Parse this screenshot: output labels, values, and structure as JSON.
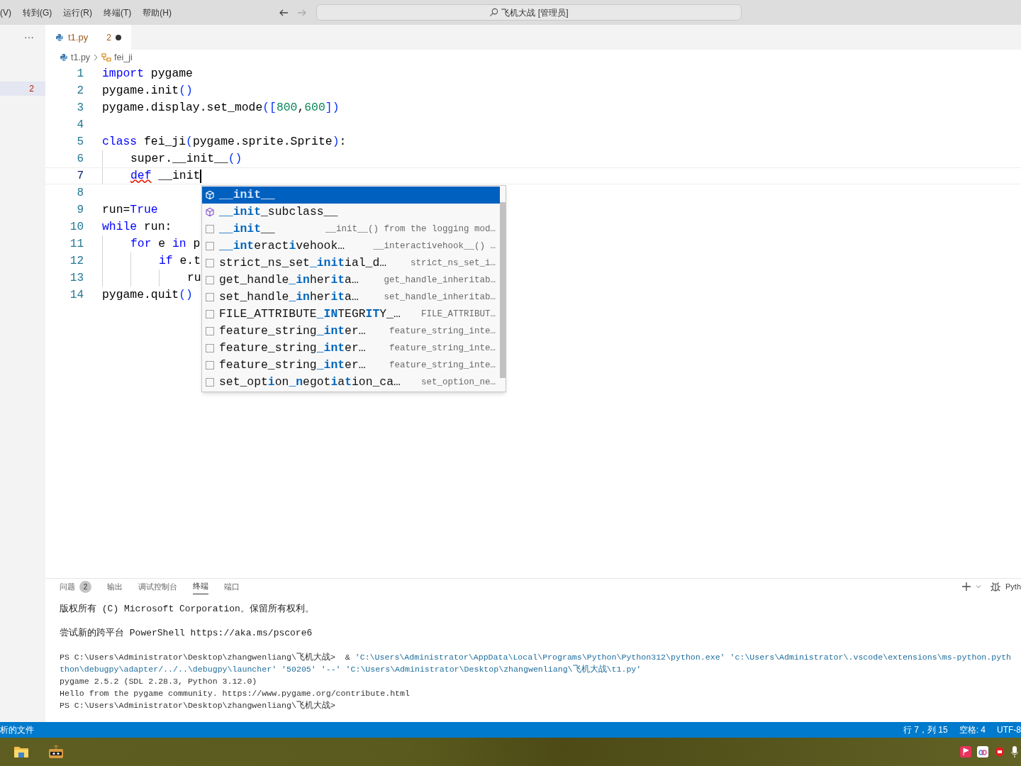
{
  "menu": [
    "(V)",
    "转到(G)",
    "运行(R)",
    "终端(T)",
    "帮助(H)"
  ],
  "search": {
    "value": "飞机大战 [管理员]"
  },
  "sidebar": {
    "more": "···",
    "problem_count": "2"
  },
  "tabs": [
    {
      "label": "t1.py",
      "badge": "2",
      "modified": true,
      "selected": true
    }
  ],
  "breadcrumb": [
    "t1.py",
    "fei_ji"
  ],
  "code": {
    "lines": [
      {
        "number": "1",
        "current": false,
        "tokens": [
          {
            "kind": "keyword",
            "text": "import"
          },
          {
            "kind": "plain",
            "text": " pygame"
          }
        ]
      },
      {
        "number": "2",
        "current": false,
        "tokens": [
          {
            "kind": "plain",
            "text": "pygame.init"
          },
          {
            "kind": "bracket",
            "text": "()"
          }
        ]
      },
      {
        "number": "3",
        "current": false,
        "tokens": [
          {
            "kind": "plain",
            "text": "pygame.display.set_mode"
          },
          {
            "kind": "bracket",
            "text": "(["
          },
          {
            "kind": "number",
            "text": "800"
          },
          {
            "kind": "plain",
            "text": ","
          },
          {
            "kind": "number",
            "text": "600"
          },
          {
            "kind": "bracket",
            "text": "])"
          }
        ]
      },
      {
        "number": "4",
        "current": false
      },
      {
        "number": "5",
        "current": false,
        "tokens": [
          {
            "kind": "keyword",
            "text": "class"
          },
          {
            "kind": "plain",
            "text": " fei_ji"
          },
          {
            "kind": "bracket",
            "text": "("
          },
          {
            "kind": "plain",
            "text": "pygame.sprite.Sprite"
          },
          {
            "kind": "bracket",
            "text": ")"
          },
          {
            "kind": "plain",
            "text": ":"
          }
        ],
        "children": [
          {
            "number": "6",
            "current": false,
            "tokens": [
              {
                "kind": "plain",
                "text": "super.__init__"
              },
              {
                "kind": "bracket",
                "text": "()"
              }
            ]
          },
          {
            "number": "7",
            "current": true,
            "tokens": [
              {
                "kind": "error",
                "text": "def"
              },
              {
                "kind": "plain",
                "text": " __init"
              }
            ]
          }
        ]
      },
      {
        "number": "8",
        "current": false
      },
      {
        "number": "9",
        "current": false,
        "tokens": [
          {
            "kind": "plain",
            "text": "run="
          },
          {
            "kind": "keyword",
            "text": "True"
          }
        ]
      },
      {
        "number": "10",
        "current": false,
        "tokens": [
          {
            "kind": "keyword",
            "text": "while"
          },
          {
            "kind": "plain",
            "text": " run:"
          }
        ],
        "children": [
          {
            "number": "11",
            "current": false,
            "tokens": [
              {
                "kind": "keyword",
                "text": "for"
              },
              {
                "kind": "plain",
                "text": " e "
              },
              {
                "kind": "keyword",
                "text": "in"
              },
              {
                "kind": "plain",
                "text": " p"
              }
            ],
            "children": [
              {
                "number": "12",
                "current": false,
                "tokens": [
                  {
                    "kind": "keyword",
                    "text": "if"
                  },
                  {
                    "kind": "plain",
                    "text": " e.t"
                  }
                ],
                "children": [
                  {
                    "number": "13",
                    "current": false,
                    "tokens": [
                      {
                        "kind": "plain",
                        "text": "ru"
                      }
                    ]
                  }
                ]
              }
            ]
          }
        ]
      },
      {
        "number": "14",
        "current": false,
        "tokens": [
          {
            "kind": "plain",
            "text": "pygame.quit"
          },
          {
            "kind": "bracket",
            "text": "()"
          }
        ]
      }
    ]
  },
  "suggestions": [
    {
      "kind": "class",
      "selected": true,
      "parts": [
        {
          "text": "__init",
          "match": true
        },
        {
          "text": "__",
          "match": false
        }
      ]
    },
    {
      "kind": "class",
      "selected": false,
      "parts": [
        {
          "text": "__init",
          "match": true
        },
        {
          "text": "_subclass__",
          "match": false
        }
      ]
    },
    {
      "kind": "text",
      "selected": false,
      "parts": [
        {
          "text": "__init",
          "match": true
        },
        {
          "text": "__",
          "match": false
        }
      ],
      "detail": "__init__() from the logging mod…"
    },
    {
      "kind": "text",
      "selected": false,
      "parts": [
        {
          "text": "__int",
          "match": true
        },
        {
          "text": "eract",
          "match": false
        },
        {
          "text": "i",
          "match": true
        },
        {
          "text": "vehook…",
          "match": false
        }
      ],
      "detail": "__interactivehook__() …"
    },
    {
      "kind": "text",
      "selected": false,
      "parts": [
        {
          "text": "strict_ns_set",
          "match": false
        },
        {
          "text": "_init",
          "match": true
        },
        {
          "text": "ial_d…",
          "match": false
        }
      ],
      "detail": "strict_ns_set_i…"
    },
    {
      "kind": "text",
      "selected": false,
      "parts": [
        {
          "text": "get_handle",
          "match": false
        },
        {
          "text": "_in",
          "match": true
        },
        {
          "text": "her",
          "match": false
        },
        {
          "text": "it",
          "match": true
        },
        {
          "text": "a…",
          "match": false
        }
      ],
      "detail": "get_handle_inheritab…"
    },
    {
      "kind": "text",
      "selected": false,
      "parts": [
        {
          "text": "set_handle",
          "match": false
        },
        {
          "text": "_in",
          "match": true
        },
        {
          "text": "her",
          "match": false
        },
        {
          "text": "it",
          "match": true
        },
        {
          "text": "a…",
          "match": false
        }
      ],
      "detail": "set_handle_inheritab…"
    },
    {
      "kind": "text",
      "selected": false,
      "parts": [
        {
          "text": "FILE_ATTRIBUTE",
          "match": false
        },
        {
          "text": "_IN",
          "match": true
        },
        {
          "text": "TEGR",
          "match": false
        },
        {
          "text": "IT",
          "match": true
        },
        {
          "text": "Y_…",
          "match": false
        }
      ],
      "detail": "FILE_ATTRIBUT…"
    },
    {
      "kind": "text",
      "selected": false,
      "parts": [
        {
          "text": "feature_string",
          "match": false
        },
        {
          "text": "_int",
          "match": true
        },
        {
          "text": "er…",
          "match": false
        }
      ],
      "detail": "feature_string_inte…"
    },
    {
      "kind": "text",
      "selected": false,
      "parts": [
        {
          "text": "feature_string",
          "match": false
        },
        {
          "text": "_int",
          "match": true
        },
        {
          "text": "er…",
          "match": false
        }
      ],
      "detail": "feature_string_inte…"
    },
    {
      "kind": "text",
      "selected": false,
      "parts": [
        {
          "text": "feature_string",
          "match": false
        },
        {
          "text": "_int",
          "match": true
        },
        {
          "text": "er…",
          "match": false
        }
      ],
      "detail": "feature_string_inte…"
    },
    {
      "kind": "text",
      "selected": false,
      "parts": [
        {
          "text": "set_opt",
          "match": false
        },
        {
          "text": "i",
          "match": true
        },
        {
          "text": "on",
          "match": false
        },
        {
          "text": "_n",
          "match": true
        },
        {
          "text": "egot",
          "match": false
        },
        {
          "text": "i",
          "match": true
        },
        {
          "text": "a",
          "match": false
        },
        {
          "text": "t",
          "match": true
        },
        {
          "text": "ion_ca…",
          "match": false
        }
      ],
      "detail": "set_option_ne…"
    }
  ],
  "panel": {
    "tabs": [
      {
        "label": "问题",
        "count": "2",
        "selected": false
      },
      {
        "label": "输出",
        "selected": false
      },
      {
        "label": "调试控制台",
        "selected": false
      },
      {
        "label": "终端",
        "selected": true
      },
      {
        "label": "端口",
        "selected": false
      }
    ],
    "profile": "Pyth",
    "terminal": [
      {
        "lines": [
          {
            "segments": [
              {
                "kind": "plain",
                "text": "版权所有 (C) Microsoft Corporation。保留所有权利。"
              }
            ]
          }
        ]
      },
      {
        "lines": [
          {
            "segments": [
              {
                "kind": "plain",
                "text": "尝试新的跨平台 PowerShell https://aka.ms/pscore6"
              }
            ]
          }
        ]
      },
      {
        "lines": [
          {
            "segments": [
              {
                "kind": "plain",
                "text": "PS C:\\Users\\Administrator\\Desktop\\zhangwenliang\\飞机大战>  & "
              },
              {
                "kind": "string",
                "text": "'C:\\Users\\Administrator\\AppData\\Local\\Programs\\Python\\Python312\\python.exe' 'c:\\Users\\Administrator\\.vscode\\extensions\\ms-python.pyth"
              }
            ]
          },
          {
            "segments": [
              {
                "kind": "string",
                "text": "thon\\debugpy\\adapter/../..\\debugpy\\launcher' '50205' '--' 'C:\\Users\\Administrator\\Desktop\\zhangwenliang\\飞机大战\\t1.py'"
              }
            ]
          },
          {
            "segments": [
              {
                "kind": "plain",
                "text": "pygame 2.5.2 (SDL 2.28.3, Python 3.12.0)"
              }
            ]
          },
          {
            "segments": [
              {
                "kind": "plain",
                "text": "Hello from the pygame community. https://www.pygame.org/contribute.html"
              }
            ]
          },
          {
            "segments": [
              {
                "kind": "plain",
                "text": "PS C:\\Users\\Administrator\\Desktop\\zhangwenliang\\飞机大战>"
              }
            ]
          }
        ]
      }
    ]
  },
  "status_bar": {
    "left": "析的文件",
    "right": [
      "行 7，列 15",
      "空格: 4",
      "UTF-8"
    ]
  }
}
